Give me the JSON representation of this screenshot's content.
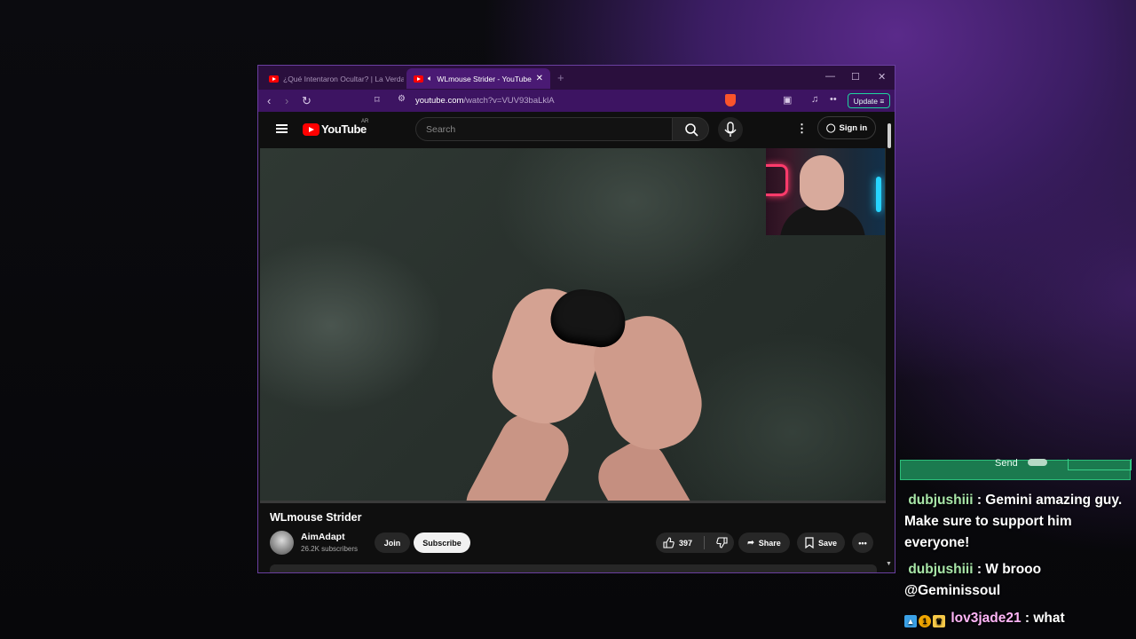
{
  "browser": {
    "tabs": [
      {
        "title": "¿Qué Intentaron Ocultar? | La Verdad",
        "active": false
      },
      {
        "title": "WLmouse Strider - YouTube",
        "active": true
      }
    ],
    "url_host": "youtube.com",
    "url_path": "/watch?v=VUV93baLklA",
    "update_label": "Update",
    "window_controls": [
      "minimize-icon",
      "maximize-icon",
      "close-icon"
    ]
  },
  "youtube": {
    "logo_text": "YouTube",
    "country_code": "AR",
    "search_placeholder": "Search",
    "signin_label": "Sign in"
  },
  "video": {
    "title": "WLmouse Strider",
    "channel": "AimAdapt",
    "subscribers": "26.2K subscribers",
    "join_label": "Join",
    "subscribe_label": "Subscribe",
    "likes": "397",
    "share_label": "Share",
    "save_label": "Save"
  },
  "chat": {
    "send_label": "Send",
    "messages": [
      {
        "user": "dubjushiii",
        "text": ": Gemini amazing guy. Make sure to support him everyone!"
      },
      {
        "user": "dubjushiii",
        "text": ": W brooo @Geminissoul"
      },
      {
        "user": "lov3jade21",
        "text": ": what",
        "badges": [
          "prime-icon",
          "subscriber-badge",
          "crown-icon"
        ],
        "badge_text": "1"
      }
    ]
  },
  "colors": {
    "youtube_red": "#ff0000",
    "browser_accent": "#4a1a74",
    "chat_green": "#1b7a4f"
  }
}
